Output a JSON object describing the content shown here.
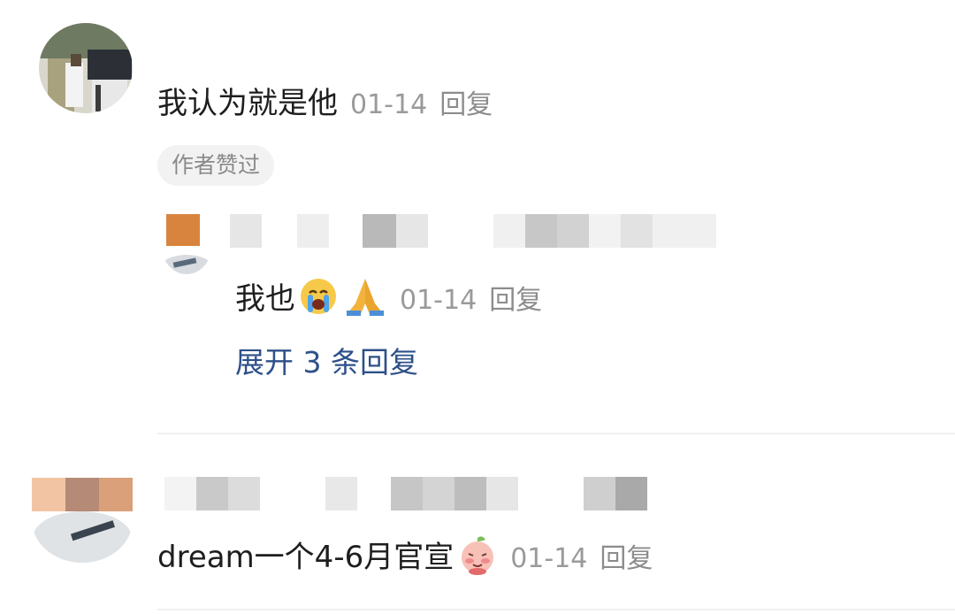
{
  "comments": [
    {
      "text": "我认为就是他",
      "date": "01-14",
      "reply_label": "回复",
      "badge": "作者赞过",
      "replies": [
        {
          "text": "我也",
          "emojis": [
            "😭",
            "🙏"
          ],
          "date": "01-14",
          "reply_label": "回复"
        }
      ],
      "expand_label": "展开 3 条回复"
    },
    {
      "text": "dream一个4-6月官宣",
      "emoji_icon": "shy-peach-sticker-icon",
      "date": "01-14",
      "reply_label": "回复"
    }
  ],
  "colors": {
    "link": "#2e5089",
    "meta": "#9a9a9a",
    "badge_bg": "#f2f2f2"
  }
}
